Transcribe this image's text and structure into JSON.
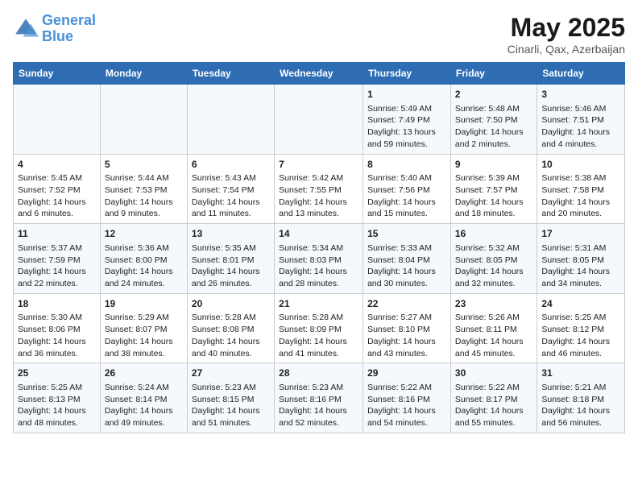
{
  "logo": {
    "line1": "General",
    "line2": "Blue"
  },
  "title": "May 2025",
  "subtitle": "Cinarli, Qax, Azerbaijan",
  "weekdays": [
    "Sunday",
    "Monday",
    "Tuesday",
    "Wednesday",
    "Thursday",
    "Friday",
    "Saturday"
  ],
  "weeks": [
    [
      {
        "day": "",
        "info": ""
      },
      {
        "day": "",
        "info": ""
      },
      {
        "day": "",
        "info": ""
      },
      {
        "day": "",
        "info": ""
      },
      {
        "day": "1",
        "info": "Sunrise: 5:49 AM\nSunset: 7:49 PM\nDaylight: 13 hours and 59 minutes."
      },
      {
        "day": "2",
        "info": "Sunrise: 5:48 AM\nSunset: 7:50 PM\nDaylight: 14 hours and 2 minutes."
      },
      {
        "day": "3",
        "info": "Sunrise: 5:46 AM\nSunset: 7:51 PM\nDaylight: 14 hours and 4 minutes."
      }
    ],
    [
      {
        "day": "4",
        "info": "Sunrise: 5:45 AM\nSunset: 7:52 PM\nDaylight: 14 hours and 6 minutes."
      },
      {
        "day": "5",
        "info": "Sunrise: 5:44 AM\nSunset: 7:53 PM\nDaylight: 14 hours and 9 minutes."
      },
      {
        "day": "6",
        "info": "Sunrise: 5:43 AM\nSunset: 7:54 PM\nDaylight: 14 hours and 11 minutes."
      },
      {
        "day": "7",
        "info": "Sunrise: 5:42 AM\nSunset: 7:55 PM\nDaylight: 14 hours and 13 minutes."
      },
      {
        "day": "8",
        "info": "Sunrise: 5:40 AM\nSunset: 7:56 PM\nDaylight: 14 hours and 15 minutes."
      },
      {
        "day": "9",
        "info": "Sunrise: 5:39 AM\nSunset: 7:57 PM\nDaylight: 14 hours and 18 minutes."
      },
      {
        "day": "10",
        "info": "Sunrise: 5:38 AM\nSunset: 7:58 PM\nDaylight: 14 hours and 20 minutes."
      }
    ],
    [
      {
        "day": "11",
        "info": "Sunrise: 5:37 AM\nSunset: 7:59 PM\nDaylight: 14 hours and 22 minutes."
      },
      {
        "day": "12",
        "info": "Sunrise: 5:36 AM\nSunset: 8:00 PM\nDaylight: 14 hours and 24 minutes."
      },
      {
        "day": "13",
        "info": "Sunrise: 5:35 AM\nSunset: 8:01 PM\nDaylight: 14 hours and 26 minutes."
      },
      {
        "day": "14",
        "info": "Sunrise: 5:34 AM\nSunset: 8:03 PM\nDaylight: 14 hours and 28 minutes."
      },
      {
        "day": "15",
        "info": "Sunrise: 5:33 AM\nSunset: 8:04 PM\nDaylight: 14 hours and 30 minutes."
      },
      {
        "day": "16",
        "info": "Sunrise: 5:32 AM\nSunset: 8:05 PM\nDaylight: 14 hours and 32 minutes."
      },
      {
        "day": "17",
        "info": "Sunrise: 5:31 AM\nSunset: 8:05 PM\nDaylight: 14 hours and 34 minutes."
      }
    ],
    [
      {
        "day": "18",
        "info": "Sunrise: 5:30 AM\nSunset: 8:06 PM\nDaylight: 14 hours and 36 minutes."
      },
      {
        "day": "19",
        "info": "Sunrise: 5:29 AM\nSunset: 8:07 PM\nDaylight: 14 hours and 38 minutes."
      },
      {
        "day": "20",
        "info": "Sunrise: 5:28 AM\nSunset: 8:08 PM\nDaylight: 14 hours and 40 minutes."
      },
      {
        "day": "21",
        "info": "Sunrise: 5:28 AM\nSunset: 8:09 PM\nDaylight: 14 hours and 41 minutes."
      },
      {
        "day": "22",
        "info": "Sunrise: 5:27 AM\nSunset: 8:10 PM\nDaylight: 14 hours and 43 minutes."
      },
      {
        "day": "23",
        "info": "Sunrise: 5:26 AM\nSunset: 8:11 PM\nDaylight: 14 hours and 45 minutes."
      },
      {
        "day": "24",
        "info": "Sunrise: 5:25 AM\nSunset: 8:12 PM\nDaylight: 14 hours and 46 minutes."
      }
    ],
    [
      {
        "day": "25",
        "info": "Sunrise: 5:25 AM\nSunset: 8:13 PM\nDaylight: 14 hours and 48 minutes."
      },
      {
        "day": "26",
        "info": "Sunrise: 5:24 AM\nSunset: 8:14 PM\nDaylight: 14 hours and 49 minutes."
      },
      {
        "day": "27",
        "info": "Sunrise: 5:23 AM\nSunset: 8:15 PM\nDaylight: 14 hours and 51 minutes."
      },
      {
        "day": "28",
        "info": "Sunrise: 5:23 AM\nSunset: 8:16 PM\nDaylight: 14 hours and 52 minutes."
      },
      {
        "day": "29",
        "info": "Sunrise: 5:22 AM\nSunset: 8:16 PM\nDaylight: 14 hours and 54 minutes."
      },
      {
        "day": "30",
        "info": "Sunrise: 5:22 AM\nSunset: 8:17 PM\nDaylight: 14 hours and 55 minutes."
      },
      {
        "day": "31",
        "info": "Sunrise: 5:21 AM\nSunset: 8:18 PM\nDaylight: 14 hours and 56 minutes."
      }
    ]
  ]
}
